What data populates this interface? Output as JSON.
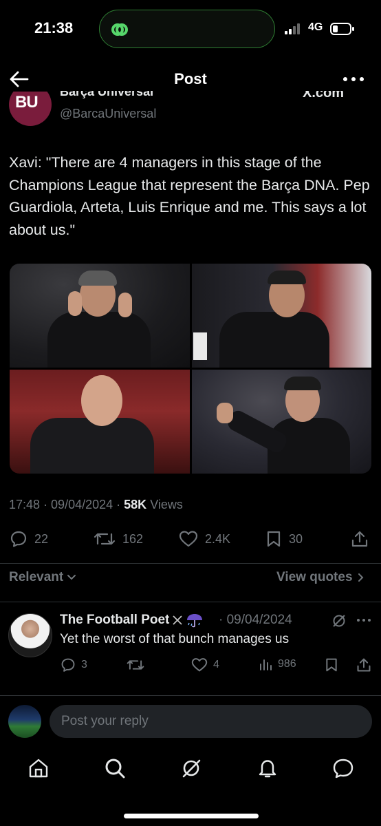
{
  "status_bar": {
    "time": "21:38",
    "network": "4G"
  },
  "header": {
    "title": "Post"
  },
  "author": {
    "avatar_text": "BU",
    "name": "Barça Universal",
    "handle": "@BarcaUniversal",
    "source": "X.com"
  },
  "tweet": {
    "text": "Xavi: \"There are 4 managers in this stage of the Champions League that represent the Barça DNA. Pep Guardiola, Arteta, Luis Enrique and me. This says a lot about us.\""
  },
  "meta": {
    "time": "17:48",
    "date": "09/04/2024",
    "views_count": "58K",
    "views_label": "Views"
  },
  "actions": {
    "replies": "22",
    "reposts": "162",
    "likes": "2.4K",
    "bookmarks": "30"
  },
  "filters": {
    "sort": "Relevant",
    "view_quotes": "View quotes"
  },
  "reply": {
    "name": "The Football Poet",
    "date": "· 09/04/2024",
    "text": "Yet the worst of that bunch manages us",
    "replies": "3",
    "likes": "4",
    "views": "986"
  },
  "composer": {
    "placeholder": "Post your reply"
  },
  "colors": {
    "background": "#000000",
    "text": "#e7e9ea",
    "muted": "#71767b",
    "divider": "#2f3336",
    "verified": "#1d9bf0"
  }
}
